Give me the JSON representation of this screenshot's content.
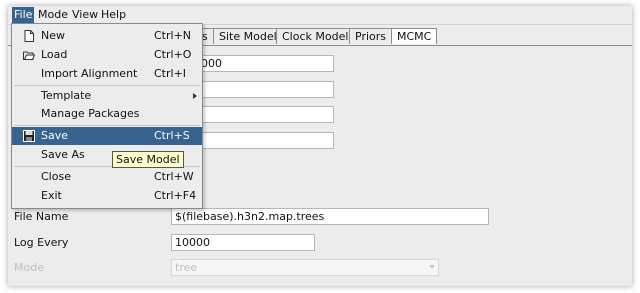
{
  "menubar": {
    "items": [
      {
        "label": "File",
        "active": true
      },
      {
        "label": "Mode"
      },
      {
        "label": "View"
      },
      {
        "label": "Help"
      }
    ]
  },
  "tabs": [
    {
      "label": "s"
    },
    {
      "label": "Site Model"
    },
    {
      "label": "Clock Model"
    },
    {
      "label": "Priors"
    },
    {
      "label": "MCMC",
      "selected": true
    }
  ],
  "file_menu": {
    "items": [
      {
        "label": "New",
        "shortcut": "Ctrl+N",
        "icon": "new-file-icon"
      },
      {
        "label": "Load",
        "shortcut": "Ctrl+O",
        "icon": "open-folder-icon"
      },
      {
        "label": "Import Alignment",
        "shortcut": "Ctrl+I"
      },
      {
        "label": "Template",
        "submenu": true
      },
      {
        "label": "Manage Packages"
      },
      {
        "label": "Save",
        "shortcut": "Ctrl+S",
        "icon": "floppy-disk-icon",
        "highlighted": true
      },
      {
        "label": "Save As"
      },
      {
        "label": "Close",
        "shortcut": "Ctrl+W"
      },
      {
        "label": "Exit",
        "shortcut": "Ctrl+F4"
      }
    ],
    "tooltip": "Save Model"
  },
  "mcmc": {
    "chain_length_value": "0000",
    "field2_value": "",
    "field3_value": "",
    "field4_value": "",
    "file_name_label": "File Name",
    "file_name_value": "$(filebase).h3n2.map.trees",
    "log_every_label": "Log Every",
    "log_every_value": "10000",
    "mode_label": "Mode",
    "mode_value": "tree"
  },
  "colors": {
    "highlight": "#36638f",
    "tooltip_bg": "#ffffcc",
    "window_bg": "#ececec"
  }
}
